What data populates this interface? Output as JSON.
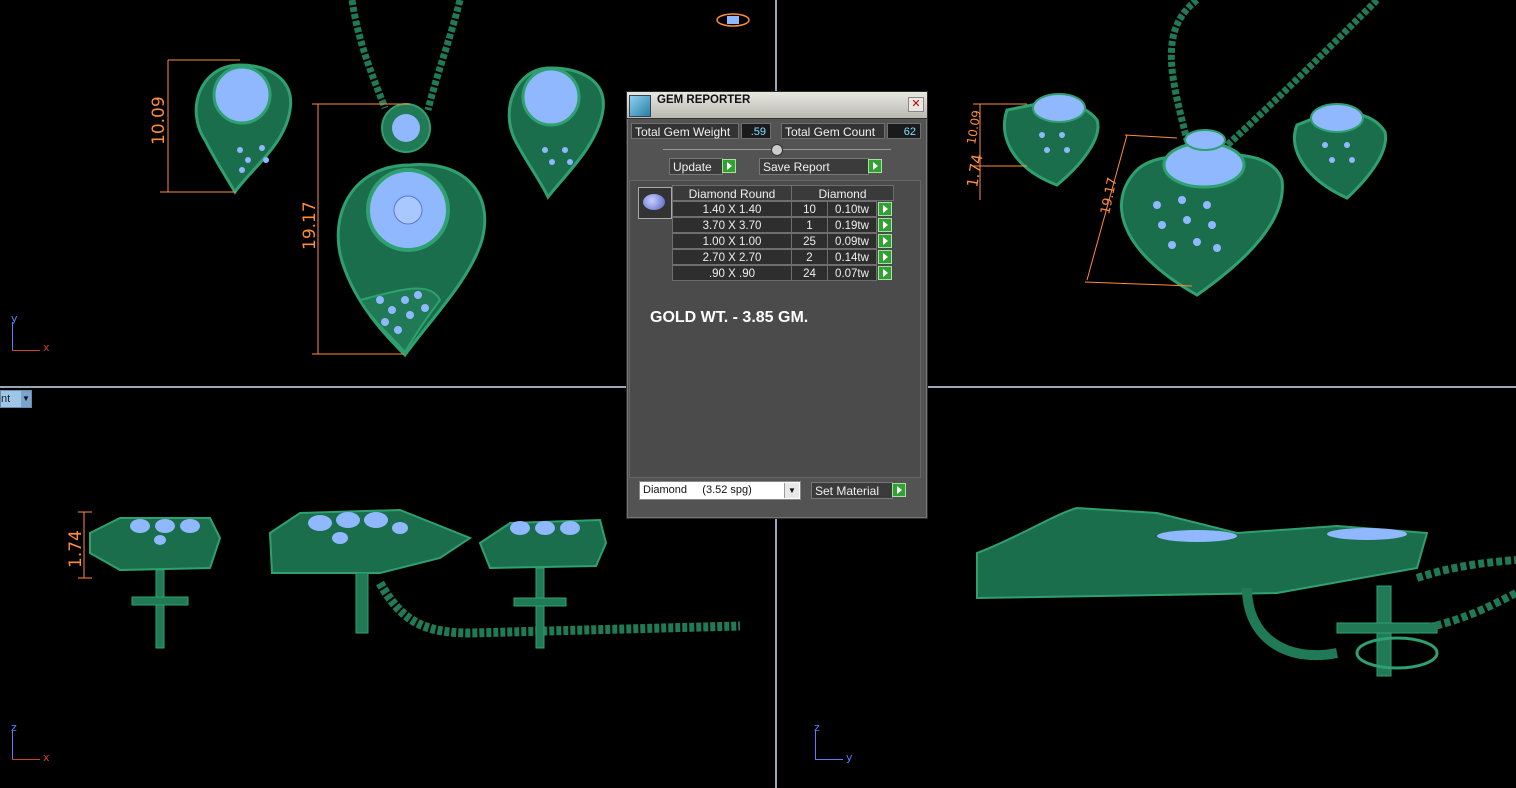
{
  "app": {
    "viewport_label": "nt",
    "axes": {
      "top_left": [
        "y",
        "x"
      ],
      "bottom_left": [
        "z",
        "x"
      ],
      "bottom_right": [
        "z",
        "y"
      ]
    }
  },
  "dimensions": {
    "top_left_a": "10.09",
    "top_left_b": "19.17",
    "top_right_a": "10.09",
    "top_right_b": "1.74",
    "top_right_c": "19.17",
    "bottom_left_a": "1.74"
  },
  "gem_reporter": {
    "title": "GEM REPORTER",
    "total_gem_weight_label": "Total Gem Weight",
    "total_gem_weight": ".59",
    "total_gem_count_label": "Total Gem Count",
    "total_gem_count": "62",
    "update_label": "Update",
    "save_report_label": "Save Report",
    "table": {
      "headers": [
        "Diamond Round",
        "Diamond"
      ],
      "rows": [
        {
          "size": "1.40 X 1.40",
          "count": "10",
          "weight": "0.10tw"
        },
        {
          "size": "3.70 X 3.70",
          "count": "1",
          "weight": "0.19tw"
        },
        {
          "size": "1.00 X 1.00",
          "count": "25",
          "weight": "0.09tw"
        },
        {
          "size": "2.70 X 2.70",
          "count": "2",
          "weight": "0.14tw"
        },
        {
          "size": ".90 X .90",
          "count": "24",
          "weight": "0.07tw"
        }
      ]
    },
    "note": "GOLD WT. - 3.85 GM.",
    "material_select": "Diamond     (3.52 spg)",
    "set_material_label": "Set Material"
  },
  "colors": {
    "metal": "#1f7a55",
    "metal_light": "#2a9a68",
    "gem": "#8fb8ff",
    "dimension": "#ff8c3a"
  }
}
